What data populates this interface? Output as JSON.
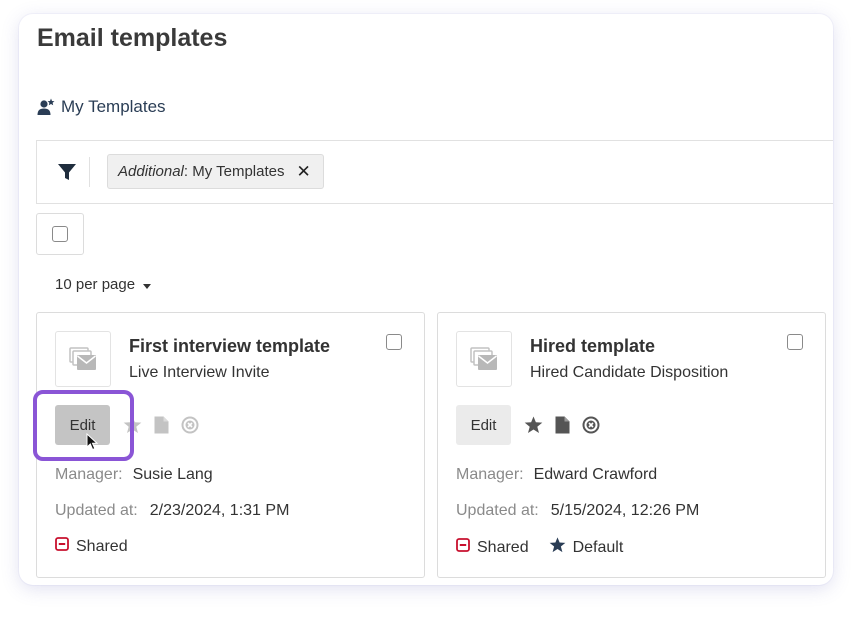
{
  "page": {
    "title": "Email templates",
    "my_templates_label": "My Templates"
  },
  "filter": {
    "chip_key": "Additional",
    "chip_value": ": My Templates",
    "chip_close": "✕"
  },
  "pagination": {
    "per_page_label": "10 per page"
  },
  "cards": [
    {
      "title": "First interview template",
      "subtitle": "Live Interview Invite",
      "edit_label": "Edit",
      "manager_label": "Manager:",
      "manager": "Susie Lang",
      "updated_label": "Updated at:",
      "updated": "2/23/2024, 1:31 PM",
      "shared_label": "Shared",
      "state": "hovered",
      "checked": false
    },
    {
      "title": "Hired template",
      "subtitle": "Hired Candidate Disposition",
      "edit_label": "Edit",
      "manager_label": "Manager:",
      "manager": "Edward Crawford",
      "updated_label": "Updated at:",
      "updated": "5/15/2024, 12:26 PM",
      "shared_label": "Shared",
      "default_label": "Default",
      "state": "normal",
      "checked": false
    }
  ],
  "icons": {
    "filter": "filter-icon",
    "user_star": "user-star-icon",
    "template_thumb": "email-template-icon",
    "star": "star-icon",
    "document": "document-icon",
    "remove": "circle-x-icon",
    "shared": "minus-square-icon"
  },
  "colors": {
    "highlight": "#8a55d6",
    "shared_icon": "#c8102e",
    "text_dark": "#333333",
    "muted": "#8a8a8a",
    "nav_text": "#2a3d55"
  }
}
